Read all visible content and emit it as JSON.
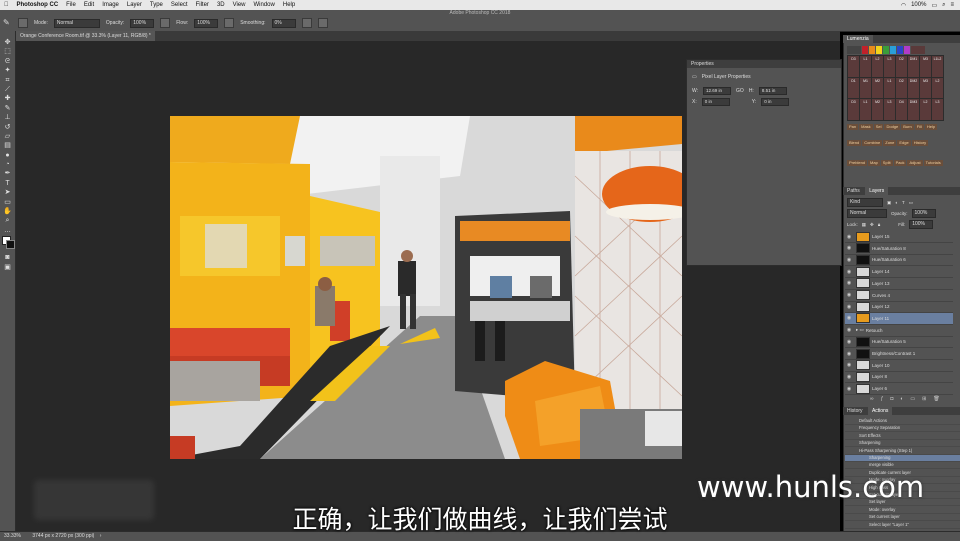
{
  "menubar": {
    "app": "Photoshop CC",
    "items": [
      "File",
      "Edit",
      "Image",
      "Layer",
      "Type",
      "Select",
      "Filter",
      "3D",
      "View",
      "Window",
      "Help"
    ],
    "battery": "100%"
  },
  "window_title": "Adobe Photoshop CC 2018",
  "options": {
    "mode_label": "Mode:",
    "mode_value": "Normal",
    "opacity_label": "Opacity:",
    "opacity_value": "100%",
    "flow_label": "Flow:",
    "flow_value": "100%",
    "smoothing_label": "Smoothing:",
    "smoothing_value": "0%"
  },
  "document_tab": "Orange Conference Room.tif @ 33.3% (Layer 11, RGB/8) *",
  "properties": {
    "title": "Properties",
    "subtitle": "Pixel Layer Properties",
    "w_label": "W:",
    "w_value": "12.69 in",
    "go_label": "GO",
    "h_label": "H:",
    "h_value": "8.51 in",
    "x_label": "X:",
    "x_value": "0 in",
    "y_label": "Y:",
    "y_value": "0 in"
  },
  "lumenzia": {
    "tab": "Lumenzia",
    "grid": [
      "D3",
      "L1",
      "L2",
      "L3",
      "D2",
      "DM1",
      "M3",
      "L1L2",
      "D1",
      "M1",
      "M2",
      "L1",
      "D2",
      "DM2",
      "M3",
      "L2",
      "D3",
      "L1",
      "M2",
      "L3",
      "D4",
      "DM3",
      "L2",
      "L3"
    ],
    "buttons1": [
      "Pan",
      "Mask",
      "Sel",
      "Dodge",
      "Burn",
      "Fill",
      "Help"
    ],
    "buttons2": [
      "Blend",
      "Combine",
      "Zone",
      "Edge",
      "History"
    ],
    "buttons3": [
      "Preblend",
      "Map",
      "Split",
      "Pack",
      "Adjust",
      "Tutorials"
    ]
  },
  "layers_panel": {
    "tabs": [
      "Paths",
      "Layers"
    ],
    "kind_label": "Kind",
    "blend_mode": "Normal",
    "opacity_label": "Opacity:",
    "opacity_value": "100%",
    "lock_label": "Lock:",
    "fill_label": "Fill:",
    "fill_value": "100%",
    "layers": [
      {
        "name": "Layer 15",
        "thumb": "orange",
        "selected": false
      },
      {
        "name": "Hue/Saturation 8",
        "thumb": "dark",
        "selected": false
      },
      {
        "name": "Hue/Saturation 6",
        "thumb": "dark",
        "selected": false
      },
      {
        "name": "Layer 14",
        "thumb": "light",
        "selected": false
      },
      {
        "name": "Layer 13",
        "thumb": "light",
        "selected": false
      },
      {
        "name": "Curves 4",
        "thumb": "light",
        "selected": false
      },
      {
        "name": "Layer 12",
        "thumb": "light",
        "selected": false
      },
      {
        "name": "Layer 11",
        "thumb": "orange",
        "selected": true
      },
      {
        "name": "Retouch",
        "thumb": "none",
        "selected": false
      },
      {
        "name": "Hue/Saturation 5",
        "thumb": "dark",
        "selected": false
      },
      {
        "name": "Brightness/Contrast 1",
        "thumb": "dark",
        "selected": false
      },
      {
        "name": "Layer 10",
        "thumb": "light",
        "selected": false
      },
      {
        "name": "Layer 8",
        "thumb": "light",
        "selected": false
      },
      {
        "name": "Layer 6",
        "thumb": "light",
        "selected": false
      }
    ]
  },
  "actions_panel": {
    "tabs": [
      "History",
      "Actions"
    ],
    "items": [
      {
        "label": "Default Actions",
        "selected": false
      },
      {
        "label": "Frequency Separation",
        "selected": false
      },
      {
        "label": "Sort Effects",
        "selected": false
      },
      {
        "label": "Sharpening",
        "selected": false
      },
      {
        "label": "Hi-Pass Sharpening (Step 1)",
        "selected": false
      },
      {
        "label": "Sharpening",
        "selected": true
      },
      {
        "label": "merge visible",
        "selected": false
      },
      {
        "label": "Duplicate current layer",
        "selected": false
      },
      {
        "label": "Mode: overlay",
        "selected": false
      },
      {
        "label": "High Pass",
        "selected": false
      },
      {
        "label": "Set current layer",
        "selected": false
      },
      {
        "label": "Set layer",
        "selected": false
      },
      {
        "label": "Mode: overlay",
        "selected": false
      },
      {
        "label": "Set current layer",
        "selected": false
      },
      {
        "label": "Select layer \"Layer 1\"",
        "selected": false
      }
    ]
  },
  "status": {
    "zoom": "33.33%",
    "doc": "3744 px x 2720 px (300 ppi)"
  },
  "subtitle": "正确，让我们做曲线，让我们尝试",
  "watermark": "www.hunls.com",
  "colors": {
    "ps_panel": "#535353",
    "canvas_bg": "#282828",
    "selection_blue": "#6a7fa0",
    "accent_orange": "#e79b1d"
  }
}
